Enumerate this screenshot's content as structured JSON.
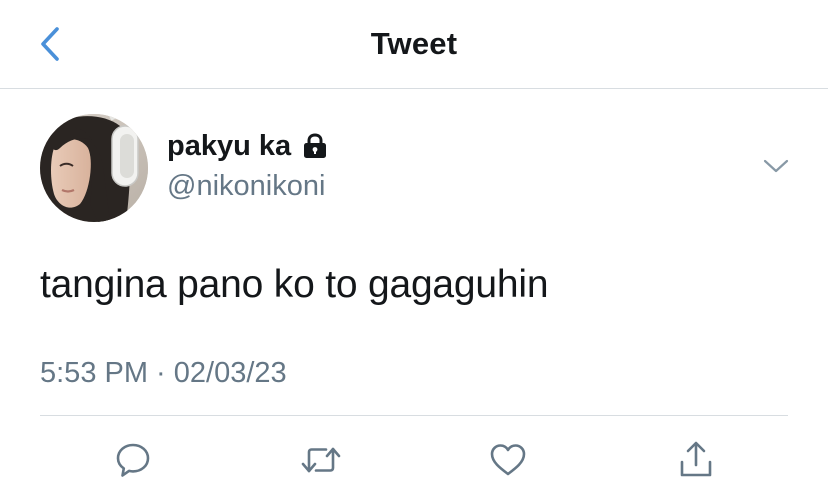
{
  "header": {
    "title": "Tweet",
    "back_icon": "chevron-left-icon",
    "accent_color": "#4a90d9"
  },
  "tweet": {
    "user": {
      "display_name": "pakyu ka",
      "handle": "@nikonikoni",
      "protected_icon": "lock-icon",
      "avatar": "avatar-photo"
    },
    "text": "tangina pano ko to gagaguhin",
    "timestamp": "5:53 PM · 02/03/23",
    "more_icon": "chevron-down-icon"
  },
  "actions": [
    {
      "name": "reply",
      "icon": "reply-icon"
    },
    {
      "name": "retweet",
      "icon": "retweet-icon"
    },
    {
      "name": "like",
      "icon": "heart-icon"
    },
    {
      "name": "share",
      "icon": "share-icon"
    }
  ],
  "colors": {
    "text_primary": "#14171a",
    "text_secondary": "#657786",
    "icon_gray": "#657786",
    "divider": "#d8dde1"
  }
}
